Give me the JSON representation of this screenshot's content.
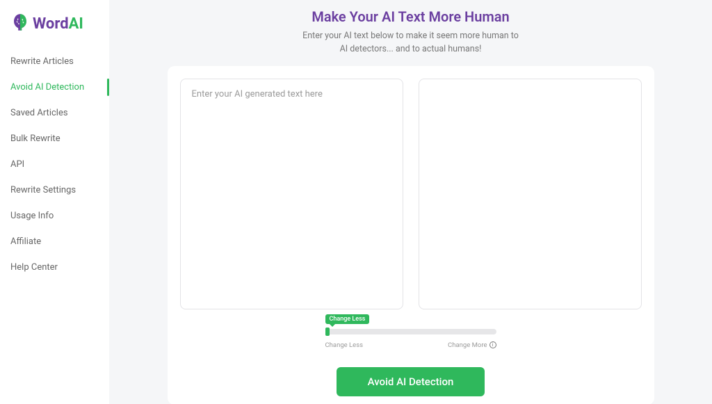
{
  "brand": {
    "word": "Word",
    "ai": "AI"
  },
  "sidebar": {
    "items": [
      {
        "label": "Rewrite Articles",
        "active": false
      },
      {
        "label": "Avoid AI Detection",
        "active": true
      },
      {
        "label": "Saved Articles",
        "active": false
      },
      {
        "label": "Bulk Rewrite",
        "active": false
      },
      {
        "label": "API",
        "active": false
      },
      {
        "label": "Rewrite Settings",
        "active": false
      },
      {
        "label": "Usage Info",
        "active": false
      },
      {
        "label": "Affiliate",
        "active": false
      },
      {
        "label": "Help Center",
        "active": false
      }
    ]
  },
  "header": {
    "title": "Make Your AI Text More Human",
    "subtitle_line1": "Enter your AI text below to make it seem more human to",
    "subtitle_line2": "AI detectors... and to actual humans!"
  },
  "input": {
    "placeholder": "Enter your AI generated text here",
    "value": ""
  },
  "output": {
    "value": ""
  },
  "slider": {
    "tooltip": "Change Less",
    "left_label": "Change Less",
    "right_label": "Change More"
  },
  "cta_label": "Avoid AI Detection"
}
